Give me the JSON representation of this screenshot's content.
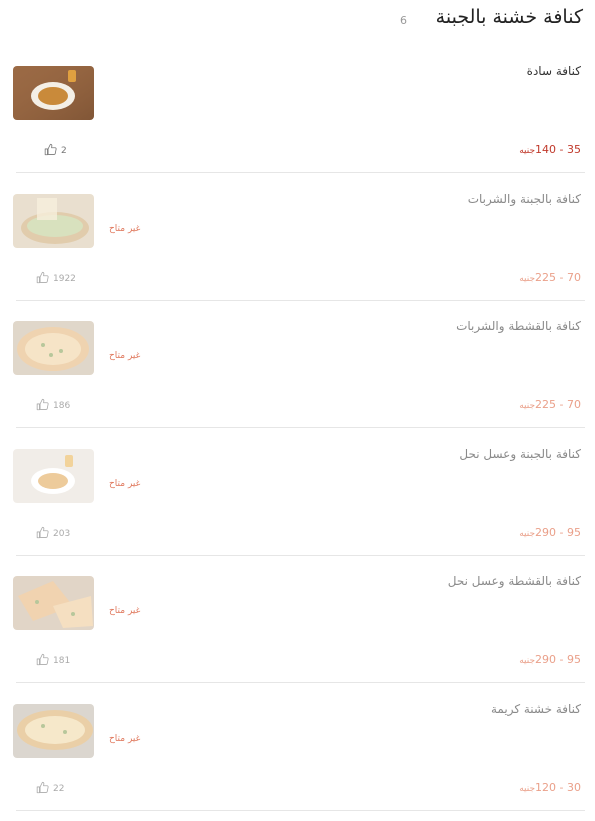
{
  "category": {
    "title": "كنافة خشنة بالجبنة",
    "count": "6"
  },
  "currency": "جنيه",
  "unavailable_label": "غير متاح",
  "colors": {
    "price": "#c0392b",
    "unavailable": "#e07a5f",
    "divider": "#e6e6e6"
  },
  "items": [
    {
      "name": "كنافة سادة",
      "price_range": "35 - 140",
      "likes": "2",
      "available": true,
      "icon": "thumbs-up-icon",
      "image": "plain-kunafa-plate"
    },
    {
      "name": "كنافة بالجبنة والشربات",
      "price_range": "70 - 225",
      "likes": "1922",
      "available": false,
      "icon": "thumbs-up-icon",
      "image": "cheese-kunafa-syrup"
    },
    {
      "name": "كنافة بالقشطة والشربات",
      "price_range": "70 - 225",
      "likes": "186",
      "available": false,
      "icon": "thumbs-up-icon",
      "image": "cream-kunafa-round"
    },
    {
      "name": "كنافة بالجبنة وعسل نحل",
      "price_range": "95 - 290",
      "likes": "203",
      "available": false,
      "icon": "thumbs-up-icon",
      "image": "cheese-kunafa-honey"
    },
    {
      "name": "كنافة بالقشطة وعسل نحل",
      "price_range": "95 - 290",
      "likes": "181",
      "available": false,
      "icon": "thumbs-up-icon",
      "image": "cream-kunafa-slices"
    },
    {
      "name": "كنافة خشنة كريمة",
      "price_range": "30 - 120",
      "likes": "22",
      "available": false,
      "icon": "thumbs-up-icon",
      "image": "creamy-kunafa-tray"
    }
  ]
}
